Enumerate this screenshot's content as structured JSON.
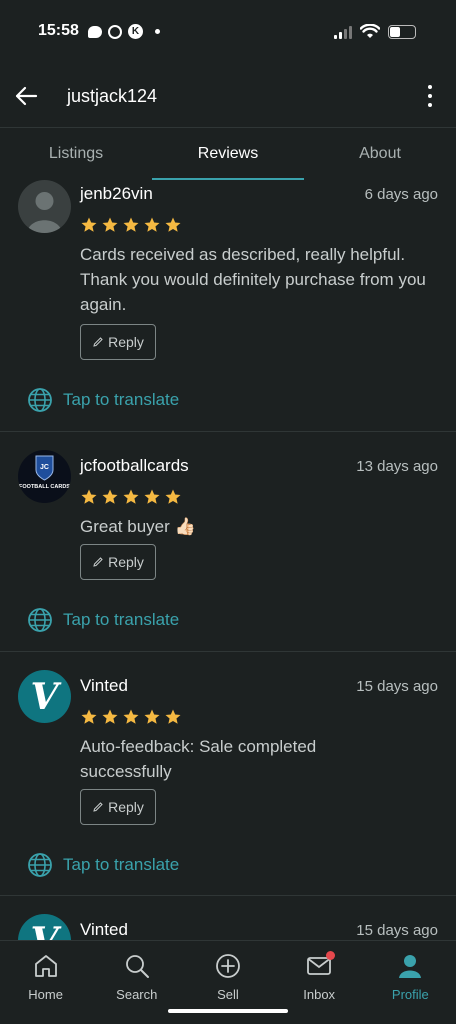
{
  "status": {
    "time": "15:58",
    "k_icon": "K"
  },
  "header": {
    "title": "justjack124",
    "back_icon": "arrow-left-icon",
    "more_icon": "more-vertical-icon"
  },
  "tabs": [
    {
      "label": "Listings"
    },
    {
      "label": "Reviews",
      "active": true
    },
    {
      "label": "About"
    }
  ],
  "reviews": [
    {
      "user": "jenb26vin",
      "time": "6 days ago",
      "stars": 5,
      "text": "Cards received as described, really helpful. Thank you would definitely purchase from you again.",
      "reply_label": "Reply",
      "translate_label": "Tap to translate"
    },
    {
      "user": "jcfootballcards",
      "time": "13 days ago",
      "stars": 5,
      "text": "Great buyer 👍🏻",
      "avatar_text": "FOOTBALL CARDS",
      "reply_label": "Reply",
      "translate_label": "Tap to translate"
    },
    {
      "user": "Vinted",
      "time": "15 days ago",
      "stars": 5,
      "text": "Auto-feedback: Sale completed successfully",
      "avatar_letter": "V",
      "reply_label": "Reply",
      "translate_label": "Tap to translate"
    },
    {
      "user": "Vinted",
      "time": "15 days ago",
      "avatar_letter": "V"
    }
  ],
  "nav": [
    {
      "label": "Home",
      "icon": "home-icon"
    },
    {
      "label": "Search",
      "icon": "search-icon"
    },
    {
      "label": "Sell",
      "icon": "plus-circle-icon"
    },
    {
      "label": "Inbox",
      "icon": "mail-icon"
    },
    {
      "label": "Profile",
      "icon": "profile-icon",
      "active": true
    }
  ],
  "colors": {
    "accent": "#3aa2ac",
    "star": "#f5b942",
    "background": "#1c2121",
    "vinted": "#0f7580"
  }
}
